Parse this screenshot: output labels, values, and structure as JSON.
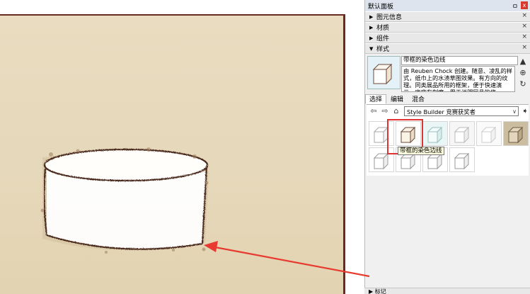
{
  "tray": {
    "title": "默认面板",
    "pin_glyph": "ㅁ",
    "close_glyph": "x"
  },
  "panels": [
    {
      "label": "图元信息",
      "state": "collapsed"
    },
    {
      "label": "材质",
      "state": "collapsed"
    },
    {
      "label": "组件",
      "state": "collapsed"
    },
    {
      "label": "样式",
      "state": "expanded"
    }
  ],
  "style": {
    "name": "带框的染色边线",
    "description": "由 Reuben Chock 创建。随意、凌乱的样式，纸巾上的水渍草图效果。有方向的纹理。同类展品所用的框架，便于快速演示。底座有刻痕，用于说明层品的信"
  },
  "tabs": [
    "选择",
    "编辑",
    "混合"
  ],
  "active_tab": "选择",
  "collection": {
    "selected": "Style Builder 竞赛获奖者"
  },
  "tooltip": "带框的染色边线",
  "bottom_panel": {
    "label": "▶ 标记"
  },
  "icons": {
    "back": "back-arrow-icon",
    "forward": "forward-arrow-icon",
    "home": "home-icon",
    "details": "details-arrow-icon"
  },
  "colors": {
    "highlight": "#e03434",
    "annotation_arrow": "#e83a30",
    "canvas_bg": "#e6d8ba",
    "frame": "#6a2a22"
  }
}
